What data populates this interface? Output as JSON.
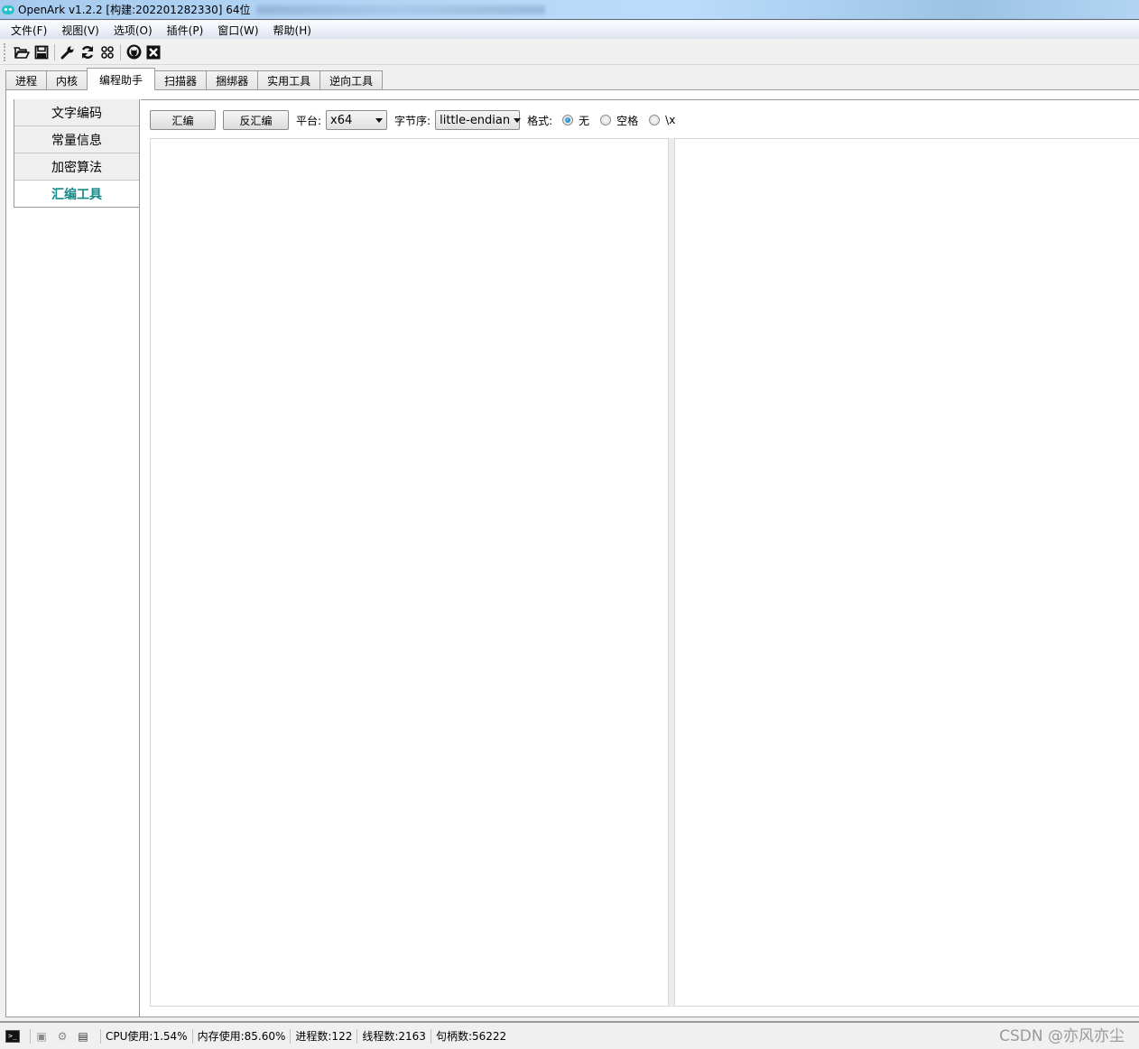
{
  "window": {
    "title": "OpenArk v1.2.2  [构建:202201282330]  64位"
  },
  "menu": [
    {
      "label": "文件(F)"
    },
    {
      "label": "视图(V)"
    },
    {
      "label": "选项(O)"
    },
    {
      "label": "插件(P)"
    },
    {
      "label": "窗口(W)"
    },
    {
      "label": "帮助(H)"
    }
  ],
  "toolbar": {
    "icons": [
      "open-folder-icon",
      "save-icon",
      "wrench-icon",
      "refresh-icon",
      "apps-icon",
      "github-icon",
      "close-box-icon"
    ]
  },
  "tabs": [
    {
      "label": "进程"
    },
    {
      "label": "内核"
    },
    {
      "label": "编程助手",
      "active": true
    },
    {
      "label": "扫描器"
    },
    {
      "label": "捆绑器"
    },
    {
      "label": "实用工具"
    },
    {
      "label": "逆向工具"
    }
  ],
  "sidebar": {
    "items": [
      {
        "label": "文字编码"
      },
      {
        "label": "常量信息"
      },
      {
        "label": "加密算法"
      },
      {
        "label": "汇编工具",
        "active": true
      }
    ]
  },
  "asm_tool": {
    "assemble_label": "汇编",
    "disassemble_label": "反汇编",
    "platform_label": "平台:",
    "platform_value": "x64",
    "endian_label": "字节序:",
    "endian_value": "little-endian",
    "format_label": "格式:",
    "format_options": [
      {
        "label": "无",
        "checked": true
      },
      {
        "label": "空格",
        "checked": false
      },
      {
        "label": "\\x",
        "checked": false
      }
    ],
    "input_text": "",
    "output_text": ""
  },
  "status": {
    "cpu": "CPU使用:1.54%",
    "memory": "内存使用:85.60%",
    "processes": "进程数:122",
    "threads": "线程数:2163",
    "handles": "句柄数:56222"
  },
  "watermark": "CSDN @亦风亦尘",
  "colors": {
    "active_sidebar": "#178a8a",
    "titlebar": "#b7d7f5"
  }
}
